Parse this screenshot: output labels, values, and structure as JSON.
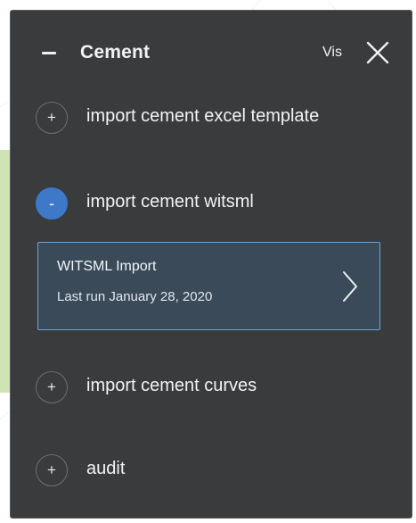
{
  "panel": {
    "title": "Cement",
    "vis_label": "Vis"
  },
  "items": [
    {
      "label": "import cement excel template",
      "icon_symbol": "+",
      "expanded": false
    },
    {
      "label": "import cement witsml",
      "icon_symbol": "-",
      "expanded": true
    },
    {
      "label": "import cement curves",
      "icon_symbol": "+",
      "expanded": false
    },
    {
      "label": "audit",
      "icon_symbol": "+",
      "expanded": false
    }
  ],
  "witsml_card": {
    "title": "WITSML Import",
    "subtitle": "Last run January 28, 2020"
  },
  "colors": {
    "panel_bg": "#393b3d",
    "accent": "#3d78c9",
    "card_border": "#6ba3d6",
    "card_bg": "#3a4a59"
  },
  "icons": {
    "collapse": "minus-icon",
    "close": "close-icon",
    "card_arrow": "chevron-right-icon"
  }
}
